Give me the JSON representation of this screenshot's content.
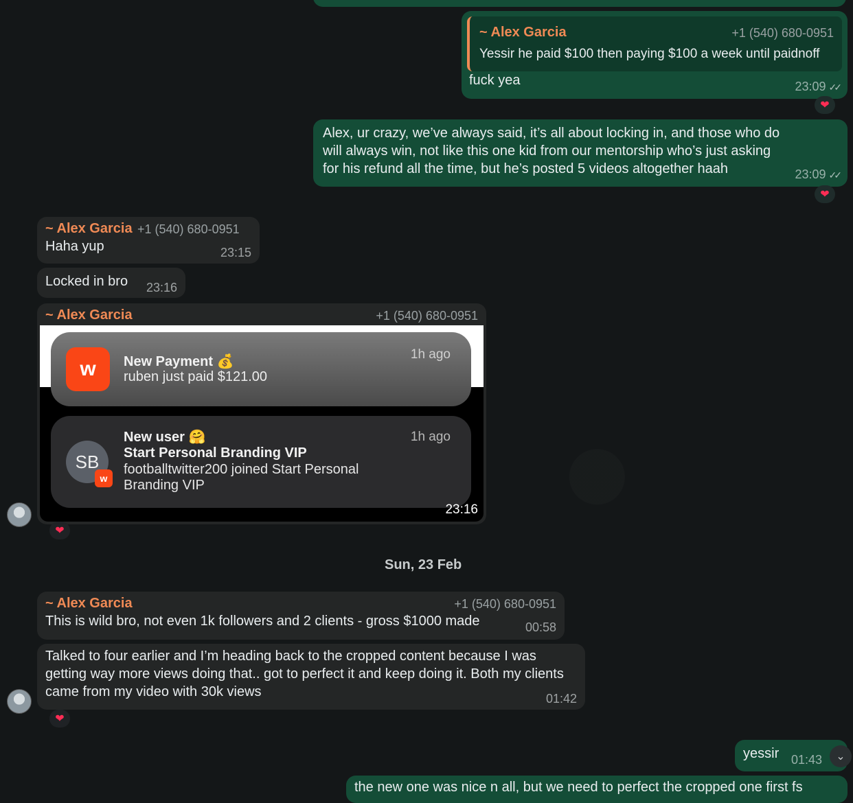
{
  "messages": [
    {
      "quoted": {
        "sender": "~ Alex Garcia",
        "phone": "+1 (540) 680-0951",
        "text": "Yessir he paid $100 then paying $100 a week until paidnoff"
      },
      "text": "fuck yea",
      "time": "23:09"
    },
    {
      "text": "Alex, ur crazy, we’ve always said, it’s all about locking in, and those who do will always win, not like this one kid from our mentorship who’s just asking for his refund all the time, but he’s posted 5 videos altogether haah",
      "time": "23:09"
    },
    {
      "sender": "~ Alex Garcia",
      "phone": "+1 (540) 680-0951",
      "text": "Haha yup",
      "time": "23:15"
    },
    {
      "text": "Locked in bro",
      "time": "23:16"
    },
    {
      "sender": "~ Alex Garcia",
      "phone": "+1 (540) 680-0951",
      "time": "23:16",
      "notifications": [
        {
          "title": "New Payment 💰",
          "body": "ruben just paid $121.00",
          "ago": "1h ago"
        },
        {
          "title": "New user 🤗",
          "subtitle": "Start Personal Branding VIP",
          "body": "footballtwitter200 joined Start Personal Branding VIP",
          "ago": "1h ago",
          "avatar": "SB"
        }
      ]
    },
    {
      "sender": "~ Alex Garcia",
      "phone": "+1 (540) 680-0951",
      "text": "This is wild bro, not even 1k followers and 2 clients - gross $1000 made",
      "time": "00:58"
    },
    {
      "text": "Talked to four earlier and I’m heading back to the cropped content because I was getting way more views doing that.. got to perfect it and keep doing it. Both my clients came from my video with 30k views",
      "time": "01:42"
    },
    {
      "text": "yessir",
      "time": "01:43"
    },
    {
      "text": "the new one was nice n all, but we need to perfect the cropped one first fs"
    }
  ],
  "date_separator": "Sun, 23 Feb",
  "reaction": "❤",
  "colors": {
    "outgoing": "#144d37",
    "incoming": "#242626",
    "sender": "#f08a55",
    "background": "#141718"
  }
}
